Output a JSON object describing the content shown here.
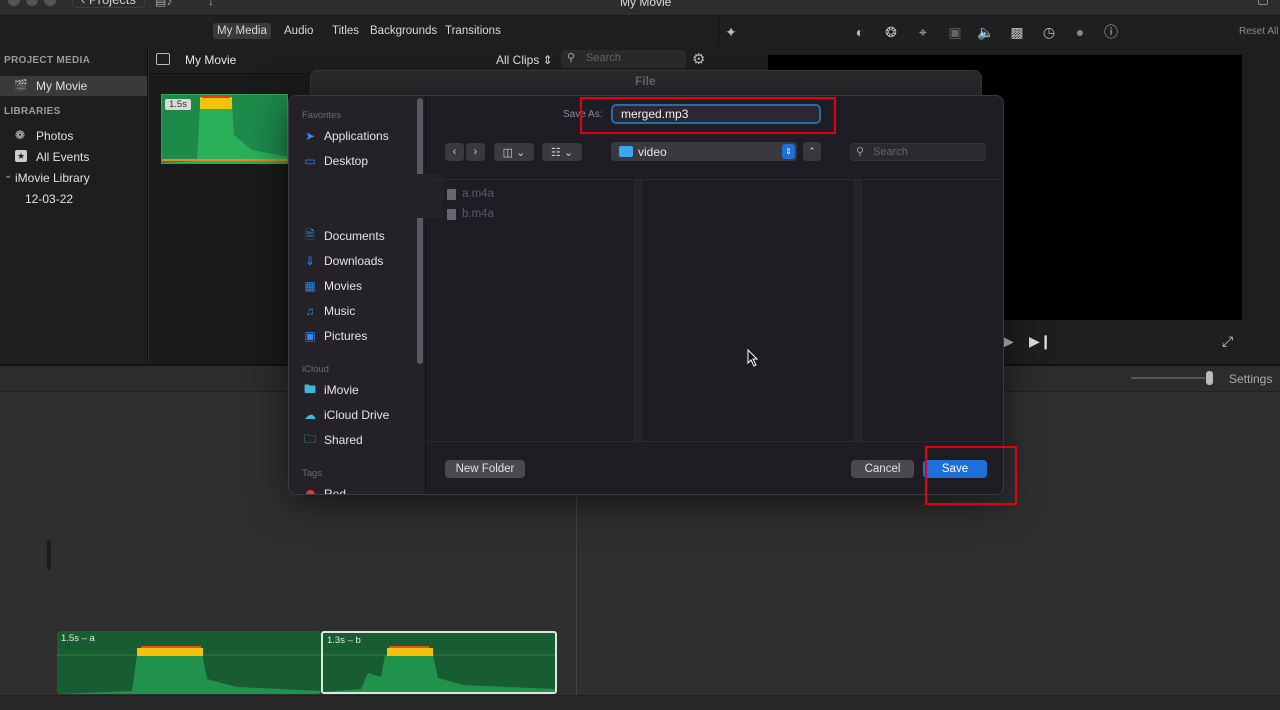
{
  "window": {
    "title": "My Movie",
    "projects_label": "Projects"
  },
  "browser_tabs": [
    {
      "label": "My Media",
      "active": true
    },
    {
      "label": "Audio",
      "active": false
    },
    {
      "label": "Titles",
      "active": false
    },
    {
      "label": "Backgrounds",
      "active": false
    },
    {
      "label": "Transitions",
      "active": false
    }
  ],
  "viewer_toolbar": {
    "icons": [
      "magic-wand-icon",
      "color-balance-icon",
      "color-palette-icon",
      "crop-icon",
      "stabilization-icon",
      "volume-icon",
      "equalizer-icon",
      "speed-icon",
      "filter-icon",
      "info-icon"
    ],
    "reset_all": "Reset All"
  },
  "sidebar": {
    "project_media_heading": "PROJECT MEDIA",
    "project_item": "My Movie",
    "libraries_heading": "LIBRARIES",
    "libraries": [
      {
        "label": "Photos",
        "icon": "photos-icon"
      },
      {
        "label": "All Events",
        "icon": "star-icon"
      },
      {
        "label": "iMovie Library",
        "icon": "chevron-down-icon"
      },
      {
        "label": "12-03-22",
        "icon": ""
      }
    ]
  },
  "media_header": {
    "title": "My Movie",
    "filter": "All Clips",
    "search_placeholder": "Search"
  },
  "media_clip": {
    "duration": "1.5s"
  },
  "timeline": {
    "settings_label": "Settings",
    "zoom_level": 1.0,
    "clips": [
      {
        "label": "1.5s – a",
        "selected": false
      },
      {
        "label": "1.3s – b",
        "selected": true
      }
    ]
  },
  "back_sheet": {
    "title": "File"
  },
  "save_dialog": {
    "save_as_label": "Save As:",
    "filename": "merged.mp3",
    "location": "video",
    "search_placeholder": "Search",
    "favorites_heading": "Favorites",
    "favorites": [
      {
        "label": "Applications",
        "icon": "applications-icon"
      },
      {
        "label": "Desktop",
        "icon": "desktop-icon"
      },
      {
        "label": "Documents",
        "icon": "document-icon"
      },
      {
        "label": "Downloads",
        "icon": "download-icon"
      },
      {
        "label": "Movies",
        "icon": "film-icon"
      },
      {
        "label": "Music",
        "icon": "music-note-icon"
      },
      {
        "label": "Pictures",
        "icon": "picture-icon"
      }
    ],
    "icloud_heading": "iCloud",
    "icloud": [
      {
        "label": "iMovie",
        "icon": "folder-icon"
      },
      {
        "label": "iCloud Drive",
        "icon": "cloud-icon"
      },
      {
        "label": "Shared",
        "icon": "shared-folder-icon"
      }
    ],
    "tags_heading": "Tags",
    "tags": [
      {
        "label": "Red",
        "color": "#e5383b"
      }
    ],
    "files": [
      "a.m4a",
      "b.m4a"
    ],
    "new_folder_label": "New Folder",
    "cancel_label": "Cancel",
    "save_label": "Save"
  },
  "colors": {
    "accent": "#1f6fd8",
    "highlight_box": "#e3000f",
    "clip_green": "#185c32"
  }
}
